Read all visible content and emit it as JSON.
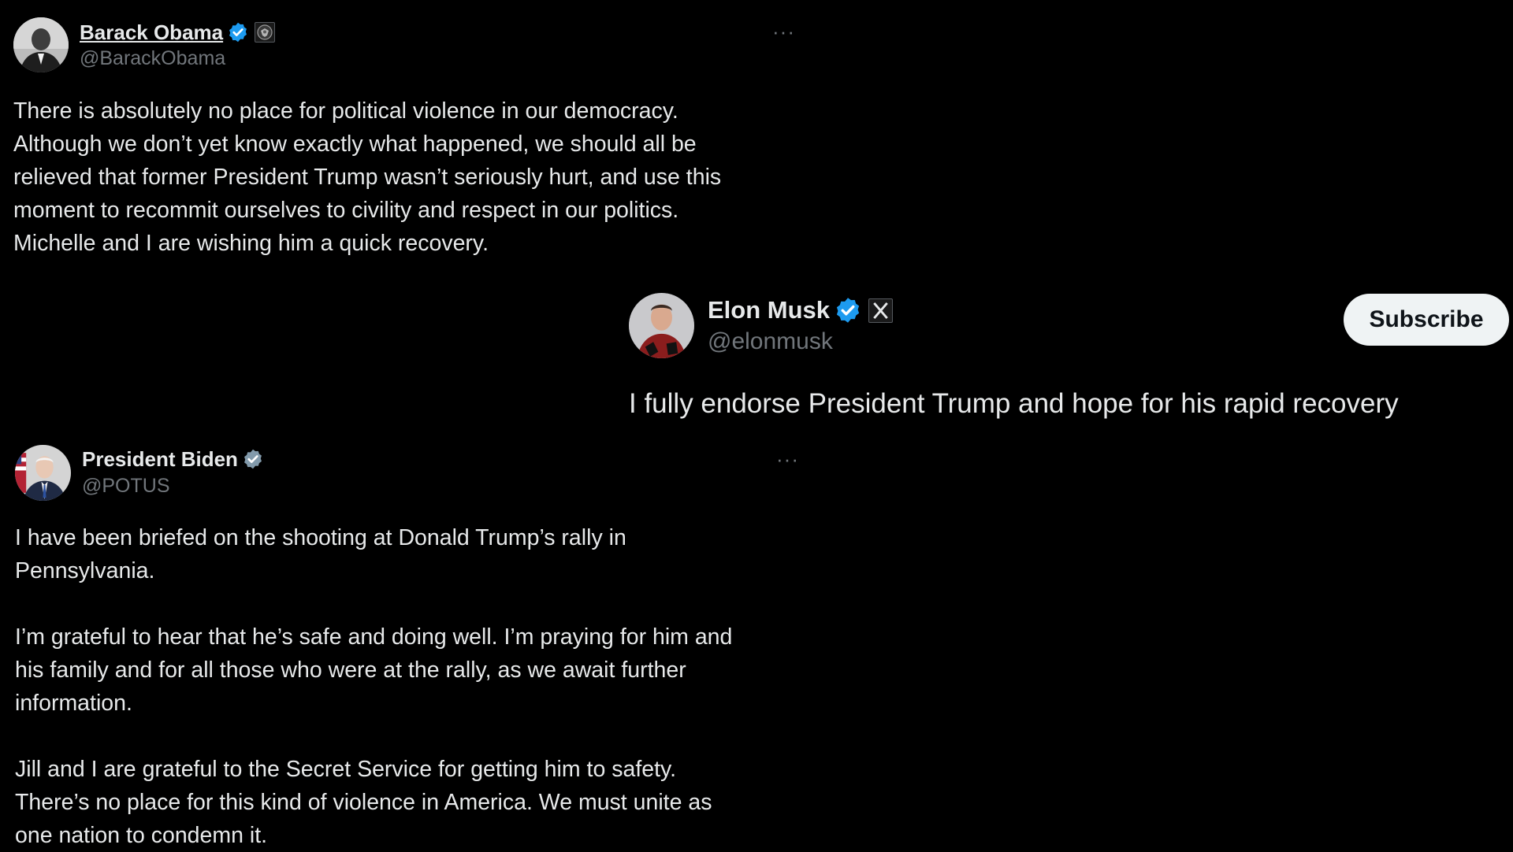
{
  "tweets": [
    {
      "display_name": "Barack Obama",
      "handle": "@BarackObama",
      "verified_badge": "blue-verified-badge-icon",
      "affiliation_badge": "presidential-seal-icon",
      "more_label": "···",
      "text": "There is absolutely no place for political violence in our democracy.\nAlthough we don’t yet know exactly what happened, we should all be\nrelieved that former President Trump wasn’t seriously hurt, and use this\nmoment to recommit ourselves to civility and respect in our politics.\nMichelle and I are wishing him a quick recovery."
    },
    {
      "display_name": "Elon Musk",
      "handle": "@elonmusk",
      "verified_badge": "blue-verified-badge-icon",
      "affiliation_badge": "x-logo-icon",
      "subscribe_label": "Subscribe",
      "text": "I fully endorse President Trump and hope for his rapid recovery"
    },
    {
      "display_name": "President Biden",
      "handle": "@POTUS",
      "verified_badge": "gray-verified-badge-icon",
      "more_label": "···",
      "text": "I have been briefed on the shooting at Donald Trump’s rally in\nPennsylvania.\n\nI’m grateful to hear that he’s safe and doing well. I’m praying for him and\nhis family and for all those who were at the rally, as we await further\ninformation.\n\nJill and I are grateful to the Secret Service for getting him to safety.\nThere’s no place for this kind of violence in America. We must unite as\none nation to condemn it."
    }
  ],
  "colors": {
    "background": "#000000",
    "text_primary": "#e7e9ea",
    "text_secondary": "#71767b",
    "verified_blue": "#1d9bf0",
    "verified_gray": "#829aab",
    "subscribe_bg": "#eff3f4"
  }
}
